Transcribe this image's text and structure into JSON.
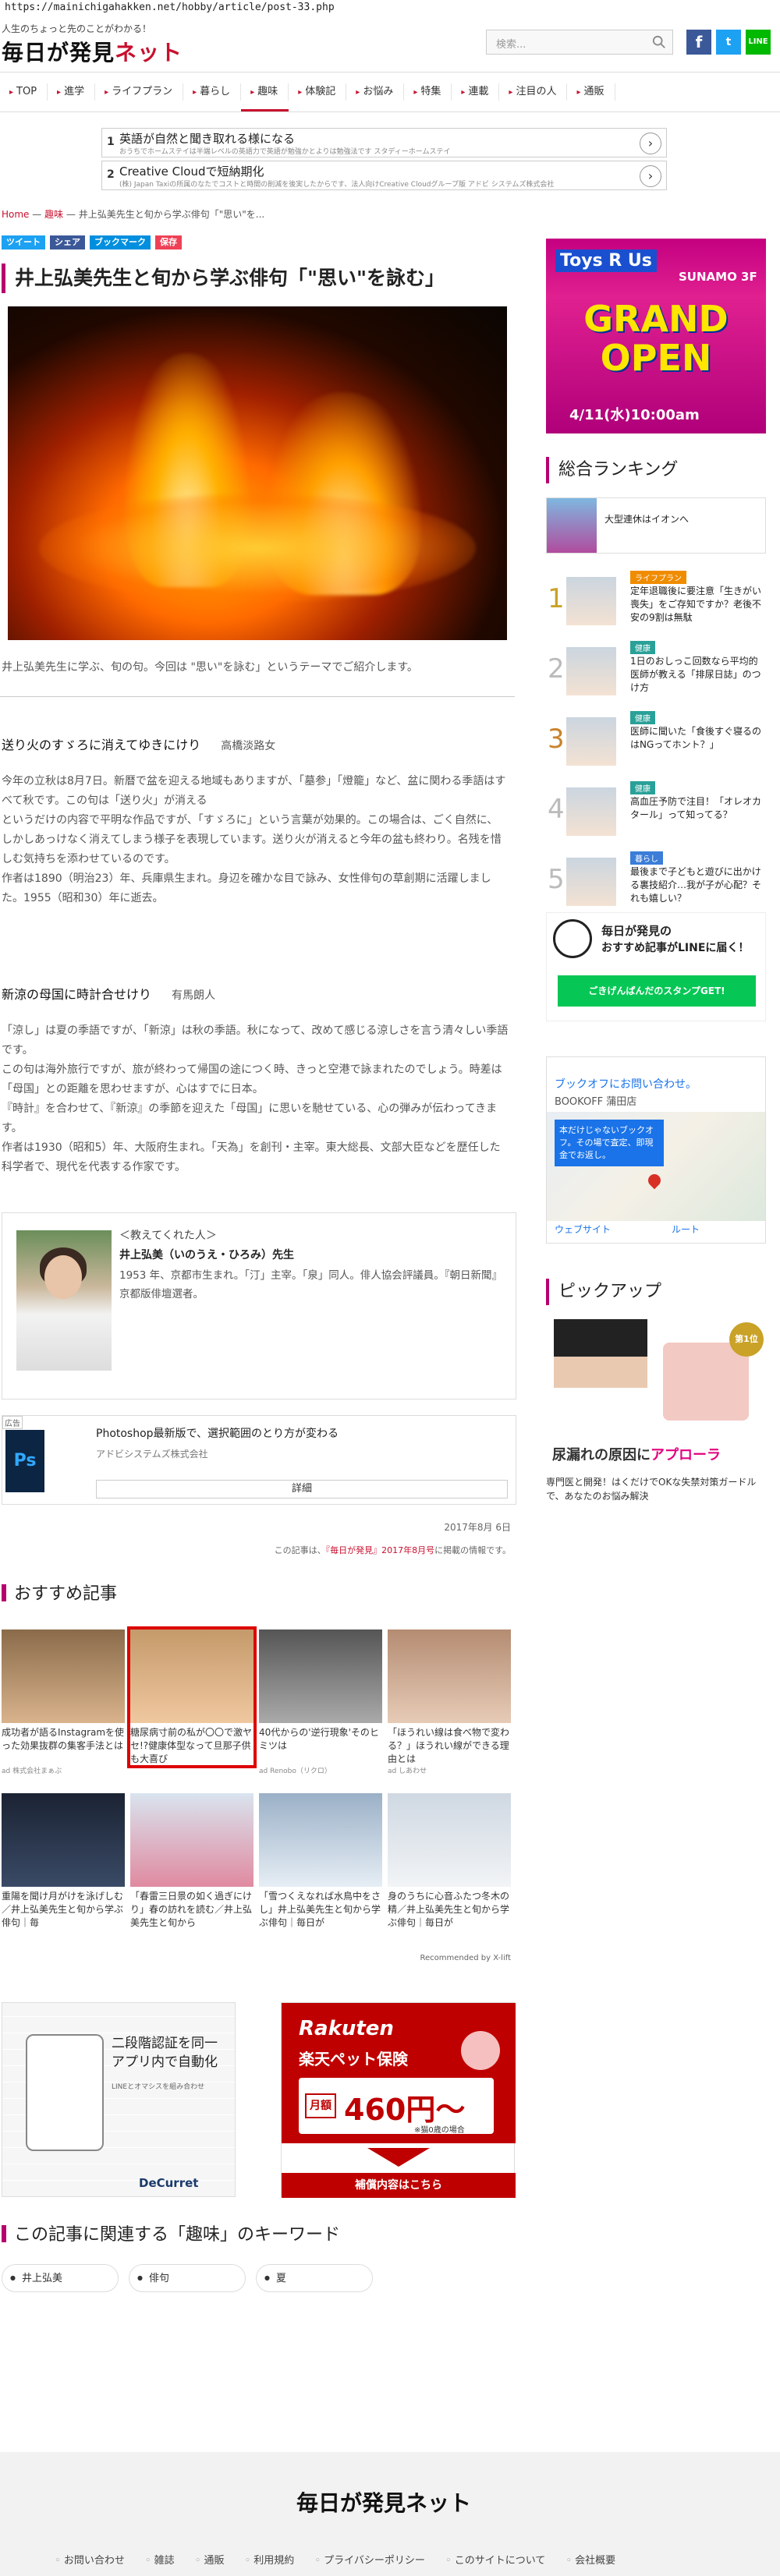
{
  "browser": {
    "url": "https://mainichigahakken.net/hobby/article/post-33.php"
  },
  "site": {
    "tagline": "人生のちょっと先のことがわかる！",
    "logo_main": "毎日が発見",
    "logo_accent": "ネット",
    "search_placeholder": "検索..."
  },
  "nav": [
    "TOP",
    "進学",
    "ライフプラン",
    "暮らし",
    "趣味",
    "体験記",
    "お悩み",
    "特集",
    "連載",
    "注目の人",
    "通販"
  ],
  "ads": {
    "row1": {
      "num": "1",
      "title": "英語が自然と聞き取れる様になる",
      "sub": "おうちでホームステイは半端レベルの英語力で英語が勉強かとよりは勉強法です スタディーホームステイ"
    },
    "row2": {
      "num": "2",
      "title": "Creative Cloudで短納期化",
      "sub": "(株) Japan Taxiの所属のなたでコストと時間の削減を後実したからです、法人向けCreative Cloudグループ版 アドビ システムズ株式会社"
    }
  },
  "breadcrumb": {
    "home": "Home",
    "sep": "—",
    "cat": "趣味",
    "current": "井上弘美先生と旬から学ぶ俳句「\"思い\"を..."
  },
  "share": {
    "tweet": "ツイート",
    "facebook": "シェア",
    "hatena": "ブックマーク",
    "pocket": "保存"
  },
  "article": {
    "title": "井上弘美先生と旬から学ぶ俳句「\"思い\"を詠む」",
    "caption": "井上弘美先生に学ぶ、旬の句。今回は \"思い\"を詠む」というテーマでご紹介します。",
    "h1": {
      "haiku": "送り火のすゞろに消えてゆきにけり",
      "author": "高橋淡路女"
    },
    "p1": "今年の立秋は8月7日。新暦で盆を迎える地域もありますが、「墓参」「燈籠」など、盆に関わる季語はすべて秋です。この句は「送り火」が消える\nというだけの内容で平明な作品ですが、「すゞろに」という言葉が効果的。この場合は、ごく自然に、しかしあっけなく消えてしまう様子を表現しています。送り火が消えると今年の盆も終わり。名残を惜しむ気持ちを添わせているのです。\n作者は1890（明治23）年、兵庫県生まれ。身辺を確かな目で詠み、女性俳句の草創期に活躍しました。1955（昭和30）年に逝去。",
    "h2": {
      "haiku": "新涼の母国に時計合せけり",
      "author": "有馬朗人"
    },
    "p2": "「涼し」は夏の季語ですが、「新涼」は秋の季語。秋になって、改めて感じる涼しさを言う清々しい季語です。\nこの句は海外旅行ですが、旅が終わって帰国の途につく時、きっと空港で詠まれたのでしょう。時差は「母国」との距離を思わせますが、心はすでに日本。\n『時計』を合わせて、『新涼』の季節を迎えた「母国」に思いを馳せている、心の弾みが伝わってきます。\n作者は1930（昭和5）年、大阪府生まれ。「天為」を創刊・主宰。東大総長、文部大臣などを歴任した科学者で、現代を代表する作家です。"
  },
  "author_box": {
    "label": "＜教えてくれた人＞",
    "name": "井上弘美（いのうえ・ひろみ）先生",
    "bio": "1953 年、京都市生まれ。「汀」主宰。「泉」同人。俳人協会評議員。『朝日新聞』京都版俳壇選者。"
  },
  "ps_ad": {
    "tag": "広告",
    "title": "Photoshop最新版で、選択範囲のとり方が変わる",
    "sponsor": "アドビシステムズ株式会社",
    "button": "詳細",
    "logo": "Ps"
  },
  "meta": {
    "date": "2017年8月 6日",
    "source_pre": "この記事は、",
    "source_link": "『毎日が発見』2017年8月号",
    "source_post": "に掲載の情報です。"
  },
  "recommend": {
    "title": "おすすめ記事",
    "by": "Recommended by X-lift",
    "items": [
      {
        "text": "成功者が語るInstagramを使った効果抜群の集客手法とは",
        "src": "ad 株式会社まぁぶ"
      },
      {
        "text": "糖尿病寸前の私が〇〇で激ヤセ!?健康体型なって旦那子供も大喜び",
        "src": ""
      },
      {
        "text": "40代からの'逆行現象'そのヒミツは",
        "src": "ad Renobo（リクロ）"
      },
      {
        "text": "「ほうれい線は食べ物で変わる？」ほうれい線ができる理由とは",
        "src": "ad しあわせ"
      },
      {
        "text": "重陽を聞け月がけを泳げしむ／井上弘美先生と旬から学ぶ俳句｜毎",
        "src": ""
      },
      {
        "text": "「春雷三日景の如く過ぎにけり」春の訪れを読む／井上弘美先生と旬から",
        "src": ""
      },
      {
        "text": "「雪つくえなれば水鳥中をさし」井上弘美先生と旬から学ぶ俳句｜毎日が",
        "src": ""
      },
      {
        "text": "身のうちに心音ふたつ冬木の精／井上弘美先生と旬から学ぶ俳句｜毎日が",
        "src": ""
      }
    ]
  },
  "bottom_ads": {
    "left": {
      "title": "二段階認証を同一アプリ内で自動化",
      "sub": "LINEとオマシスを組み合わせ",
      "brand": "DeCurret"
    },
    "right": {
      "brand": "Rakuten",
      "sub": "楽天ペット保険",
      "price_label": "月額",
      "price": "460円〜",
      "note": "※猫0歳の場合",
      "button": "補償内容はこちら"
    }
  },
  "keywords": {
    "title": "この記事に関連する「趣味」のキーワード",
    "items": [
      "井上弘美",
      "俳句",
      "夏"
    ]
  },
  "footer": {
    "logo": "毎日が発見ネット",
    "links": [
      "お問い合わせ",
      "雑誌",
      "通販",
      "利用規約",
      "プライバシーポリシー",
      "このサイトについて",
      "会社概要"
    ]
  },
  "sidebar": {
    "toysrus": {
      "brand": "Toys R Us",
      "sub": "SUNAMO 3F",
      "big": "GRAND OPEN",
      "date": "4/11(水)10:00am"
    },
    "ranking_title": "総合ランキング",
    "ranking_ad": "大型連休はイオンへ",
    "ranking": [
      {
        "n": "1",
        "badge": "ライフプラン",
        "text": "定年退職後に要注意「生きがい喪失」をご存知ですか？老後不安の9割は無駄"
      },
      {
        "n": "2",
        "badge": "健康",
        "text": "1日のおしっこ回数なら平均的医師が教える「排尿日誌」のつけ方"
      },
      {
        "n": "3",
        "badge": "健康",
        "text": "医師に聞いた「食後すぐ寝るのはNGってホント？」"
      },
      {
        "n": "4",
        "badge": "健康",
        "text": "高血圧予防で注目！「オレオカタール」って知ってる？"
      },
      {
        "n": "5",
        "badge": "暮らし",
        "text": "最後まで子どもと遊びに出かける裏技紹介…我が子が心配？それも嬉しい？"
      }
    ],
    "line": {
      "title": "毎日が発見の",
      "sub": "おすすめ記事がLINEに届く！",
      "button": "ごきげんぱんだのスタンプGET!"
    },
    "map": {
      "title": "ブックオフにお問い合わせ。",
      "sub": "BOOKOFF 蒲田店",
      "bubble": "本だけじゃないブックオフ。その場で査定、即現金でお返し。",
      "btn1": "ウェブサイト",
      "btn2": "ルート"
    },
    "pickup_title": "ピックアップ",
    "pickup": {
      "badge": "第1位",
      "h1": "尿漏れの原因に",
      "h2": "アプローラ",
      "text": "専門医と開発！はくだけでOKな失禁対策ガードルで、あなたのお悩み解決"
    }
  },
  "colors": {
    "accent": "#c8102e",
    "section": "#b5006e",
    "line": "#06c755",
    "rakuten": "#bf0000"
  }
}
